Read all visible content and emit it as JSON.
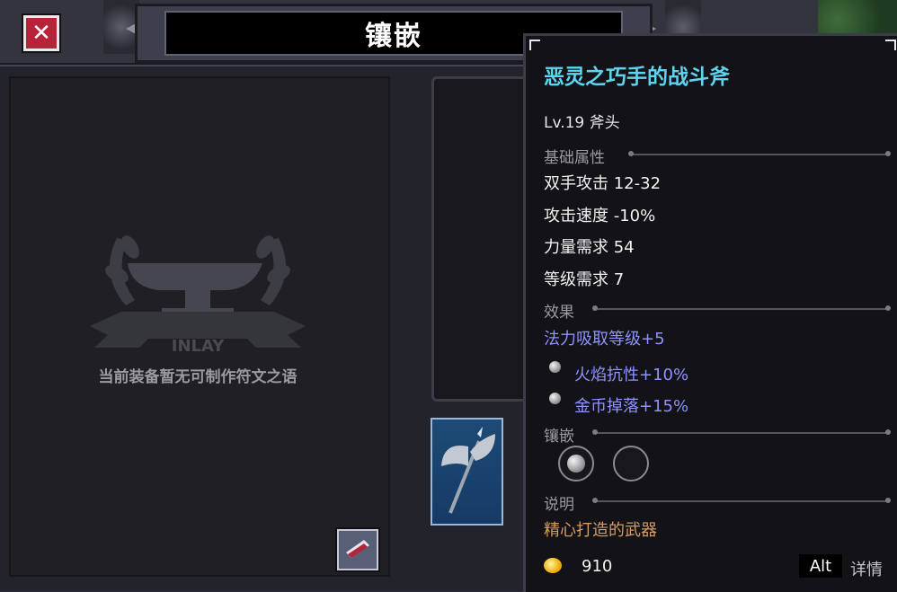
{
  "window": {
    "title": "镶嵌",
    "close_icon": "close-icon"
  },
  "left_panel": {
    "emblem_text": "INLAY",
    "empty_message": "当前装备暂无可制作符文之语"
  },
  "item_tooltip": {
    "name": "恶灵之巧手的战斗斧",
    "level_type": "Lv.19 斧头",
    "sections": {
      "base": "基础属性",
      "effects": "效果",
      "inlay": "镶嵌",
      "description": "说明"
    },
    "base_stats": [
      "双手攻击 12-32",
      "攻击速度 -10%",
      "力量需求 54",
      "等级需求 7"
    ],
    "effect_main": "法力吸取等级+5",
    "gem_effects": [
      "火焰抗性+10%",
      "金币掉落+15%"
    ],
    "sockets": [
      "filled",
      "empty"
    ],
    "description": "精心打造的武器",
    "price": "910",
    "alt_key": "Alt",
    "alt_label": "详情",
    "colors": {
      "name": "#5fd4f0",
      "effect": "#8e93ff",
      "description": "#d79a62"
    }
  }
}
